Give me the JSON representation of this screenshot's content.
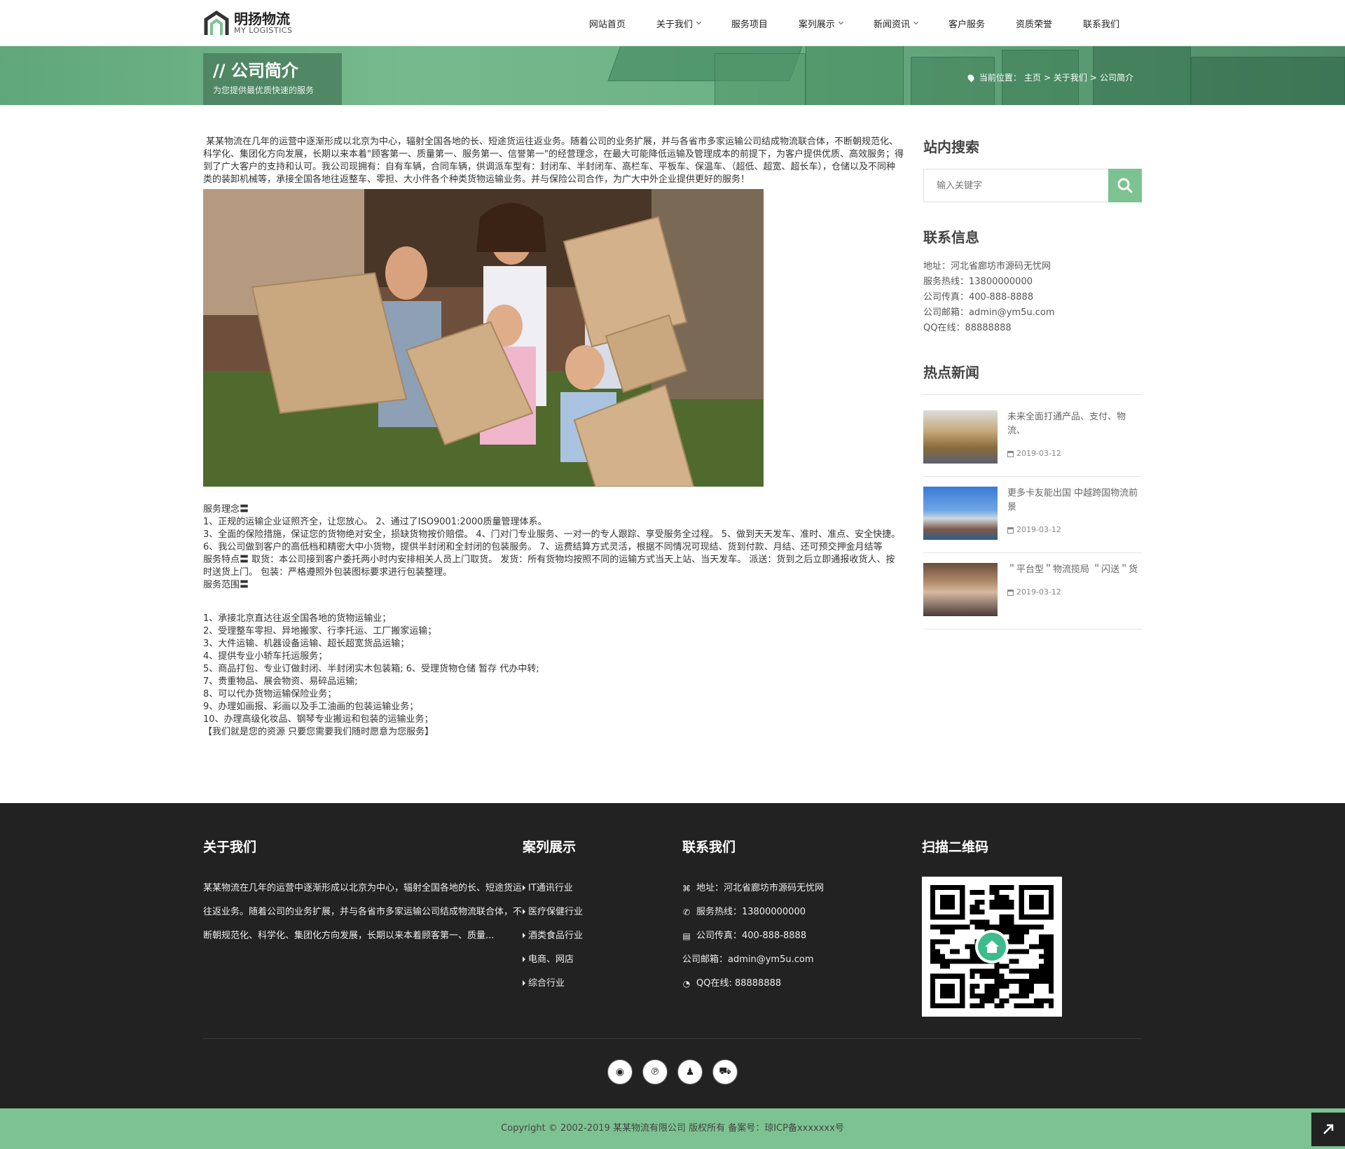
{
  "brand": {
    "name": "明扬物流",
    "sub": "MY LOGISTICS"
  },
  "nav": [
    {
      "label": "网站首页",
      "dropdown": false
    },
    {
      "label": "关于我们",
      "dropdown": true
    },
    {
      "label": "服务项目",
      "dropdown": false
    },
    {
      "label": "案列展示",
      "dropdown": true
    },
    {
      "label": "新闻资讯",
      "dropdown": true
    },
    {
      "label": "客户服务",
      "dropdown": false
    },
    {
      "label": "资质荣誉",
      "dropdown": false
    },
    {
      "label": "联系我们",
      "dropdown": false
    }
  ],
  "banner": {
    "title": "// 公司简介",
    "subtitle": "为您提供最优质快速的服务",
    "crumb_prefix": "当前位置：",
    "crumbs": [
      "主页",
      "关于我们",
      "公司简介"
    ],
    "sep": ">"
  },
  "content": {
    "intro": "某某物流在几年的运营中逐渐形成以北京为中心，辐射全国各地的长、短途货运往返业务。随着公司的业务扩展，并与各省市多家运输公司结成物流联合体，不断朝规范化、科学化、集团化方向发展，长期以来本着\"顾客第一、质量第一、服务第一、信誉第一\"的经营理念，在最大可能降低运输及管理成本的前提下，为客户提供优质、高效服务；得到了广大客户的支持和认可。我公司现拥有：自有车辆，合同车辆，供调派车型有：封闭车、半封闭车、高栏车、平板车、保温车、（超低、超宽、超长车），仓储以及不同种类的装卸机械等，承接全国各地往返整车、零担、大小件各个种类货物运输业务。并与保险公司合作，为广大中外企业提供更好的服务！",
    "lines": [
      "服务理念〓",
      "1、正规的运输企业证照齐全，让您放心。 2、通过了ISO9001:2000质量管理体系。",
      "3、全面的保险措施，保证您的货物绝对安全，损缺货物按价赔偿。 4、门对门专业服务、一对一的专人跟踪、享受服务全过程。 5、做到天天发车、准时、准点、安全快捷。 6、我公司做到客户的高低档和精密大中小货物，提供半封闭和全封闭的包装服务。 7、运费结算方式灵活，根据不同情况可现结、货到付款、月结、还可预交押金月结等",
      "服务特点〓 取货：本公司接到客户委托两小时内安排相关人员上门取货。 发货：所有货物均按照不同的运输方式当天上站、当天发车。 派送：货到之后立即通报收货人、按时送货上门。 包装：严格遵照外包装图标要求进行包装整理。",
      "服务范围〓"
    ],
    "scope": [
      "1、承接北京直达往返全国各地的货物运输业；",
      "2、受理整车零担、异地搬家、行李托运、工厂搬家运输；",
      "3、大件运输、机器设备运输、超长超宽货品运输；",
      "4、提供专业小轿车托运服务；",
      "5、商品打包、专业订做封闭、半封闭实木包装箱; 6、受理货物仓储 暂存 代办中转;",
      "7、贵重物品、展会物资、易碎品运输;",
      "8、可以代办货物运输保险业务；",
      "9、办理如画报、彩画以及手工油画的包装运输业务；",
      "10、办理高级化妆品、钢琴专业搬运和包装的运输业务；",
      "【我们就是您的资源 只要您需要我们随时愿意为您服务】"
    ]
  },
  "sidebar": {
    "search_title": "站内搜索",
    "search_placeholder": "输入关键字",
    "contact_title": "联系信息",
    "contact": [
      "地址：河北省廊坊市源码无忧网",
      "服务热线：13800000000",
      "公司传真：400-888-8888",
      "公司邮箱：admin@ym5u.com",
      "QQ在线：88888888"
    ],
    "news_title": "热点新闻",
    "news": [
      {
        "title": "未来全面打通产品、支付、物流、",
        "date": "2019-03-12"
      },
      {
        "title": "更多卡友能出国 中越跨国物流前景",
        "date": "2019-03-12"
      },
      {
        "title": "＂平台型＂物流揽局 ＂闪送＂货",
        "date": "2019-03-12"
      }
    ]
  },
  "footer": {
    "about_title": "关于我们",
    "about_text": "某某物流在几年的运营中逐渐形成以北京为中心，辐射全国各地的长、短途货运往返业务。随着公司的业务扩展，并与各省市多家运输公司结成物流联合体，不断朝规范化、科学化、集团化方向发展，长期以来本着顾客第一、质量...",
    "cases_title": "案列展示",
    "cases": [
      "IT通讯行业",
      "医疗保健行业",
      "酒类食品行业",
      "电商、网店",
      "综合行业"
    ],
    "contact_title": "联系我们",
    "contact": [
      {
        "icon": "map-icon",
        "glyph": "⌘",
        "text": "地址：河北省廊坊市源码无忧网"
      },
      {
        "icon": "phone-icon",
        "glyph": "✆",
        "text": "服务热线：13800000000"
      },
      {
        "icon": "printer-icon",
        "glyph": "▤",
        "text": "公司传真：400-888-8888"
      },
      {
        "icon": "",
        "glyph": "",
        "text": "公司邮箱：admin@ym5u.com"
      },
      {
        "icon": "qq-icon",
        "glyph": "◔",
        "text": "QQ在线: 88888888"
      }
    ],
    "qr_title": "扫描二维码",
    "socials": [
      {
        "icon": "weibo-icon",
        "glyph": "◉"
      },
      {
        "icon": "pinterest-icon",
        "glyph": "℗"
      },
      {
        "icon": "qq-penguin-icon",
        "glyph": "♟"
      },
      {
        "icon": "cart-icon",
        "glyph": "⛟"
      }
    ],
    "copyright": "Copyright © 2002-2019 某某物流有限公司 版权所有 备案号：琼ICP备xxxxxxx号"
  },
  "colors": {
    "accent": "#7dc391",
    "footer_bg": "#222222"
  }
}
